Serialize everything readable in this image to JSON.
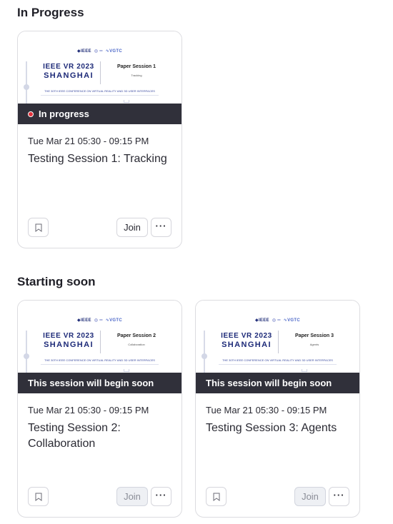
{
  "sections": [
    {
      "title": "In Progress",
      "cards": [
        {
          "thumbnail": {
            "logos": "⊗IEEE  ◎ ⁠ ⁠ ⁠ ⁠ ⁠ ⁠ ⁠ ⁠ ·  ∿⁠",
            "brand_line1": "IEEE VR 2023",
            "brand_line2": "SHANGHAI",
            "session_name": "Paper Session 1",
            "session_topic": "Tracking",
            "footer": "THE 30TH IEEE CONFERENCE ON VIRTUAL REALITY AND 3D USER INTERFACES"
          },
          "status": "In progress",
          "time": "Tue Mar 21 05:30 - 09:15 PM",
          "title": "Testing Session 1: Tracking",
          "join_label": "Join",
          "more_label": "···",
          "join_enabled": true
        }
      ]
    },
    {
      "title": "Starting soon",
      "cards": [
        {
          "thumbnail": {
            "logos": "⊗IEEE  ◎ ⁠ ⁠ ⁠ ⁠ ⁠ ⁠ ⁠ ⁠ ·  ∿⁠",
            "brand_line1": "IEEE VR 2023",
            "brand_line2": "SHANGHAI",
            "session_name": "Paper Session 2",
            "session_topic": "Collaboration",
            "footer": "THE 30TH IEEE CONFERENCE ON VIRTUAL REALITY AND 3D USER INTERFACES"
          },
          "status": "This session will begin soon",
          "time": "Tue Mar 21 05:30 - 09:15 PM",
          "title": "Testing Session 2: Collaboration",
          "join_label": "Join",
          "more_label": "···",
          "join_enabled": false
        },
        {
          "thumbnail": {
            "logos": "⊗IEEE  ◎ ⁠ ⁠ ⁠ ⁠ ⁠ ⁠ ⁠ ⁠ ·  ∿⁠",
            "brand_line1": "IEEE VR 2023",
            "brand_line2": "SHANGHAI",
            "session_name": "Paper Session 3",
            "session_topic": "Agents",
            "footer": "THE 30TH IEEE CONFERENCE ON VIRTUAL REALITY AND 3D USER INTERFACES"
          },
          "status": "This session will begin soon",
          "time": "Tue Mar 21 05:30 - 09:15 PM",
          "title": "Testing Session 3: Agents",
          "join_label": "Join",
          "more_label": "···",
          "join_enabled": false
        }
      ]
    }
  ],
  "icons": {
    "live": "live-dot-icon",
    "bookmark": "bookmark-icon",
    "more": "more-horizontal-icon"
  },
  "colors": {
    "status_bar": "#30303a",
    "live_dot": "#e0303a",
    "brand_text": "#1d2a78"
  }
}
